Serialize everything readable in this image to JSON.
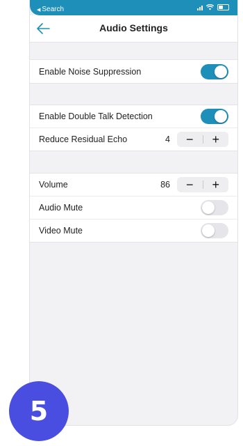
{
  "status_bar": {
    "back_label": "Search",
    "color": "#1d8fb8"
  },
  "nav": {
    "title": "Audio Settings",
    "back_icon": "arrow-left-icon"
  },
  "noise": {
    "label": "Enable Noise Suppression",
    "enabled": true
  },
  "echo": {
    "double_talk_label": "Enable Double Talk Detection",
    "double_talk_enabled": true,
    "residual_label": "Reduce Residual Echo",
    "residual_value": "4",
    "minus": "−",
    "plus": "+"
  },
  "media": {
    "volume_label": "Volume",
    "volume_value": "86",
    "minus": "−",
    "plus": "+",
    "audio_mute_label": "Audio Mute",
    "audio_mute_enabled": false,
    "video_mute_label": "Video Mute",
    "video_mute_enabled": false
  },
  "badge": {
    "number": "5",
    "color": "#4a4ee0"
  }
}
